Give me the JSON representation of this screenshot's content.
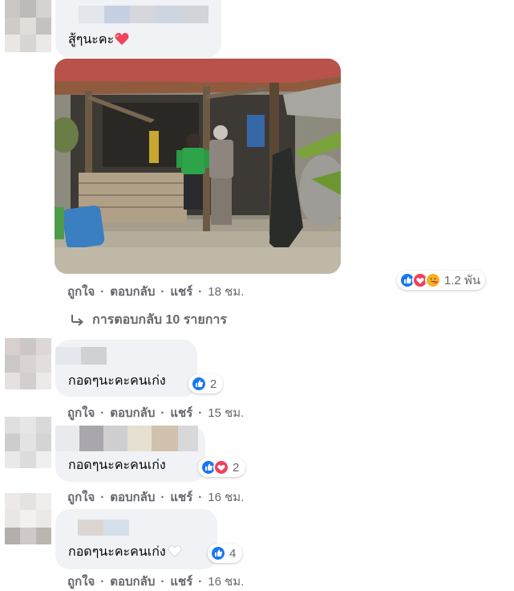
{
  "actions": {
    "like": "ถูกใจ",
    "reply": "ตอบกลับ",
    "share": "แชร์",
    "separator": "·"
  },
  "comments": [
    {
      "text": "สู้ๆนะคะ",
      "time": "18 ชม.",
      "reactions": [
        "like-icon",
        "love-icon",
        "care-icon"
      ],
      "reaction_count": "1.2 พัน"
    },
    {
      "text": "กอดๆนะคะคนเก่ง",
      "time": "15 ชม.",
      "reactions": [
        "like-icon"
      ],
      "reaction_count": "2"
    },
    {
      "text": "กอดๆนะคะคนเก่ง",
      "time": "16 ชม.",
      "reactions": [
        "like-icon",
        "love-icon"
      ],
      "reaction_count": "2"
    },
    {
      "text": "กอดๆนะคะคนเก่ง",
      "time": "16 ชม.",
      "reactions": [
        "like-icon"
      ],
      "reaction_count": "4"
    }
  ],
  "replies_link": "การตอบกลับ 10 รายการ",
  "colors": {
    "bubble": "#f0f2f5",
    "meta_text": "#65676b",
    "like_blue": "#1877f2",
    "love_red": "#f33e58",
    "care_yellow": "#f7b125"
  }
}
